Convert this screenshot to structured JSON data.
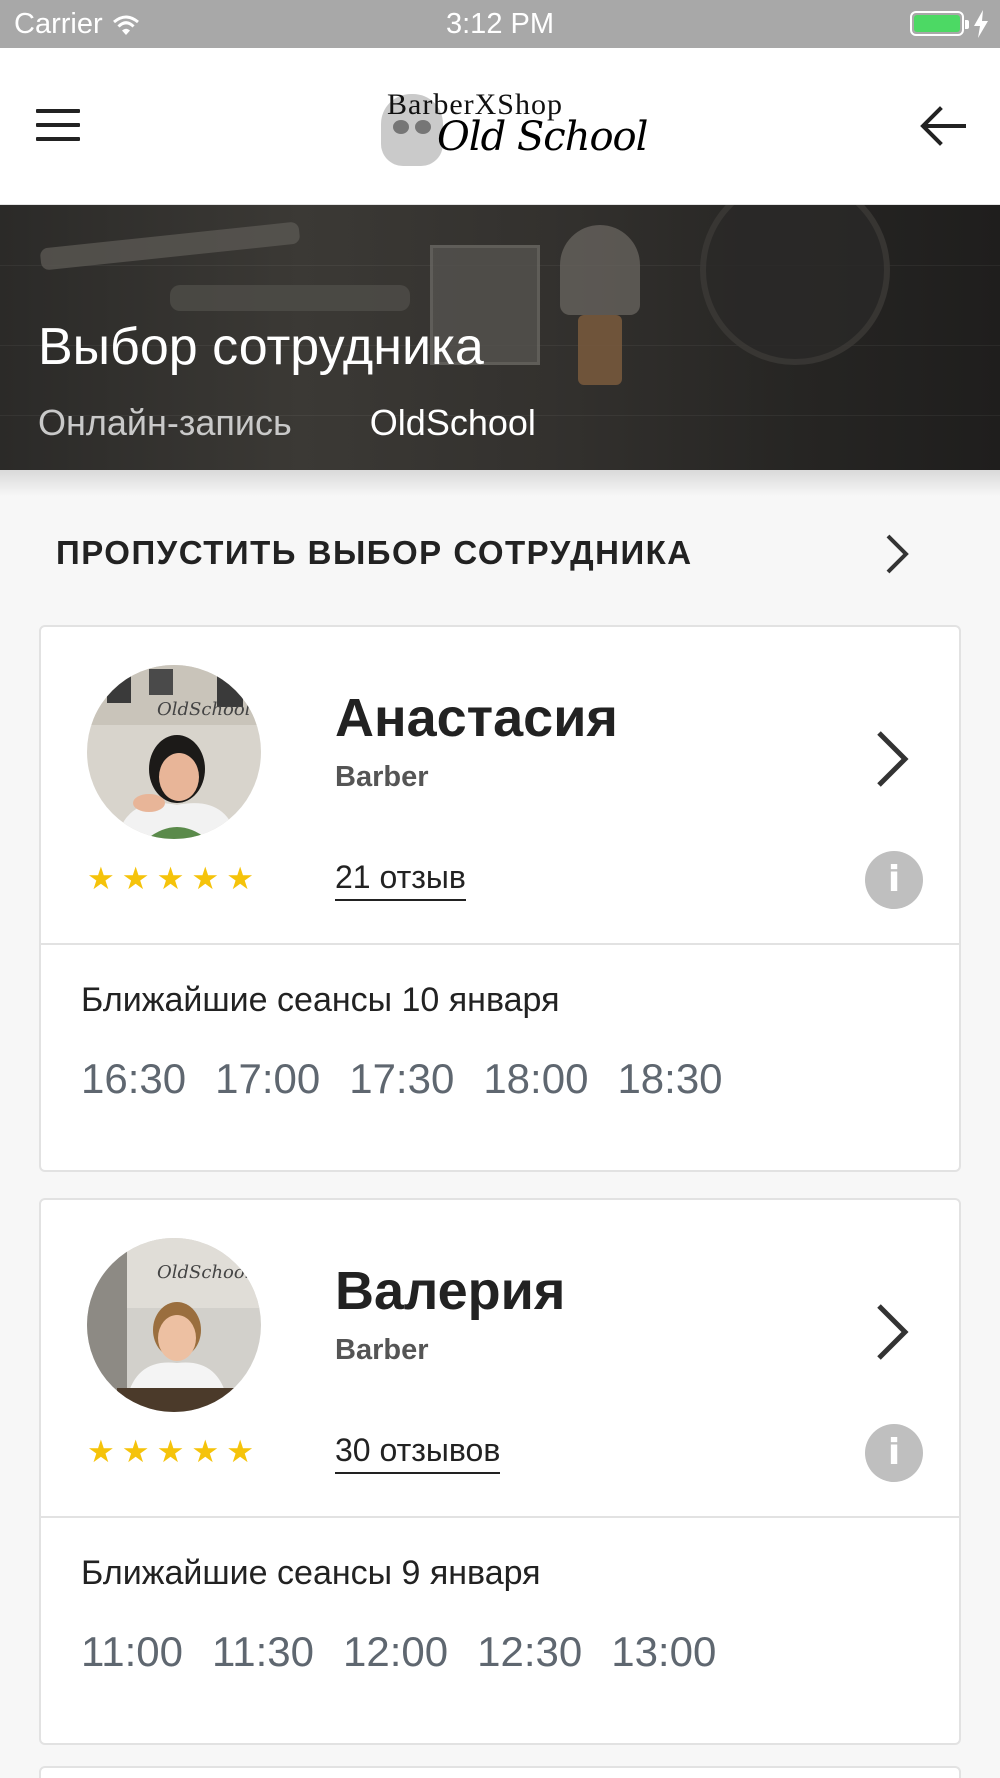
{
  "status_bar": {
    "carrier": "Carrier",
    "time": "3:12 PM",
    "battery_level": 1.0
  },
  "header": {
    "logo_top": "BarberXShop",
    "logo_bottom": "Old School"
  },
  "hero": {
    "title": "Выбор сотрудника",
    "breadcrumbs": [
      "Онлайн-запись",
      "OldSchool"
    ]
  },
  "skip": {
    "label": "ПРОПУСТИТЬ ВЫБОР СОТРУДНИКА"
  },
  "employees": [
    {
      "name": "Анастасия",
      "role": "Barber",
      "rating_stars": 5,
      "reviews": "21 отзыв",
      "sessions_label": "Ближайшие сеансы 10 января",
      "slots": [
        "16:30",
        "17:00",
        "17:30",
        "18:00",
        "18:30"
      ]
    },
    {
      "name": "Валерия",
      "role": "Barber",
      "rating_stars": 5,
      "reviews": "30 отзывов",
      "sessions_label": "Ближайшие сеансы 9 января",
      "slots": [
        "11:00",
        "11:30",
        "12:00",
        "12:30",
        "13:00"
      ]
    }
  ],
  "colors": {
    "accent_star": "#f5c30a",
    "status_bar": "#a8a8a8",
    "battery": "#4cd964",
    "slot_text": "#5f6770"
  },
  "icons": {
    "menu": "hamburger-icon",
    "back": "arrow-left-icon",
    "chevron": "chevron-right-icon",
    "info": "info-icon",
    "star": "star-icon"
  }
}
